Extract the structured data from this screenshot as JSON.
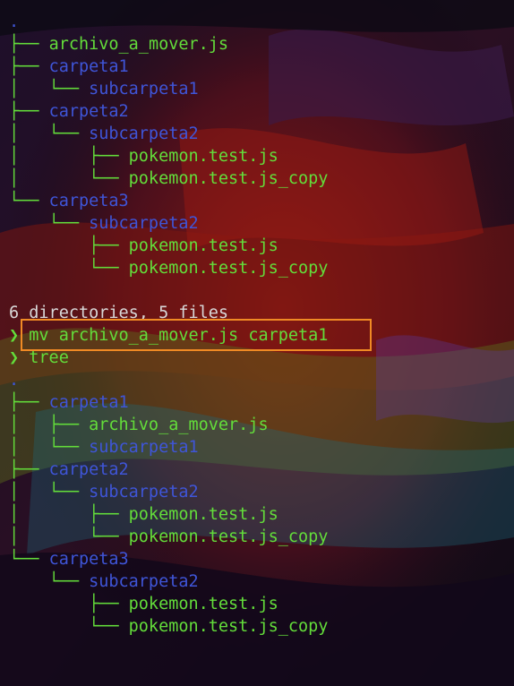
{
  "terminal": {
    "colors": {
      "green": "#63dd3a",
      "blue": "#3f55d8",
      "highlight": "#f08a24"
    },
    "tree_before": {
      "root": ".",
      "entries": [
        {
          "prefix": "├── ",
          "name": "archivo_a_mover.js",
          "type": "file"
        },
        {
          "prefix": "├── ",
          "name": "carpeta1",
          "type": "dir"
        },
        {
          "prefix": "│   └── ",
          "name": "subcarpeta1",
          "type": "dir"
        },
        {
          "prefix": "├── ",
          "name": "carpeta2",
          "type": "dir"
        },
        {
          "prefix": "│   └── ",
          "name": "subcarpeta2",
          "type": "dir"
        },
        {
          "prefix": "│       ├── ",
          "name": "pokemon.test.js",
          "type": "file"
        },
        {
          "prefix": "│       └── ",
          "name": "pokemon.test.js_copy",
          "type": "file"
        },
        {
          "prefix": "└── ",
          "name": "carpeta3",
          "type": "dir"
        },
        {
          "prefix": "    └── ",
          "name": "subcarpeta2",
          "type": "dir"
        },
        {
          "prefix": "        ├── ",
          "name": "pokemon.test.js",
          "type": "file"
        },
        {
          "prefix": "        └── ",
          "name": "pokemon.test.js_copy",
          "type": "file"
        }
      ]
    },
    "summary": "6 directories, 5 files",
    "prompt_symbol": "❯",
    "command_1": "mv archivo_a_mover.js carpeta1",
    "command_2": "tree",
    "tree_after": {
      "root": ".",
      "entries": [
        {
          "prefix": "├── ",
          "name": "carpeta1",
          "type": "dir"
        },
        {
          "prefix": "│   ├── ",
          "name": "archivo_a_mover.js",
          "type": "file"
        },
        {
          "prefix": "│   └── ",
          "name": "subcarpeta1",
          "type": "dir"
        },
        {
          "prefix": "├── ",
          "name": "carpeta2",
          "type": "dir"
        },
        {
          "prefix": "│   └── ",
          "name": "subcarpeta2",
          "type": "dir"
        },
        {
          "prefix": "│       ├── ",
          "name": "pokemon.test.js",
          "type": "file"
        },
        {
          "prefix": "│       └── ",
          "name": "pokemon.test.js_copy",
          "type": "file"
        },
        {
          "prefix": "└── ",
          "name": "carpeta3",
          "type": "dir"
        },
        {
          "prefix": "    └── ",
          "name": "subcarpeta2",
          "type": "dir"
        },
        {
          "prefix": "        ├── ",
          "name": "pokemon.test.js",
          "type": "file"
        },
        {
          "prefix": "        └── ",
          "name": "pokemon.test.js_copy",
          "type": "file"
        }
      ]
    }
  }
}
